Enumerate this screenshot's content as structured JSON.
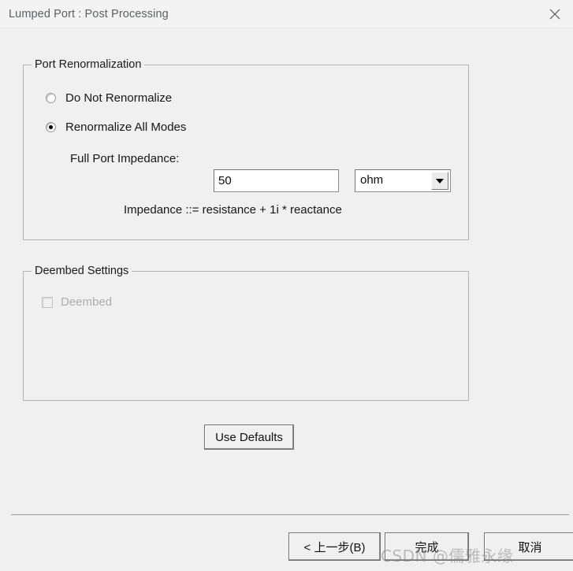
{
  "window": {
    "title": "Lumped Port : Post Processing",
    "close_icon": "close-icon"
  },
  "port_renormalization": {
    "group_title": "Port Renormalization",
    "options": [
      {
        "label": "Do Not Renormalize",
        "selected": false
      },
      {
        "label": "Renormalize All Modes",
        "selected": true
      }
    ],
    "impedance": {
      "label": "Full Port Impedance:",
      "value": "50",
      "placeholder": "",
      "unit_selected": "ohm",
      "unit_options": [
        "ohm"
      ],
      "dropdown_icon": "chevron-down-icon"
    },
    "hint": "Impedance ::= resistance + 1i * reactance"
  },
  "deembed_settings": {
    "group_title": "Deembed Settings",
    "checkbox": {
      "label": "Deembed",
      "checked": false,
      "disabled": true
    }
  },
  "buttons": {
    "use_defaults": "Use Defaults",
    "back": "< 上一步(B)",
    "finish": "完成",
    "cancel": "取消"
  },
  "watermark": {
    "text": "CSDN @儒雅永缘"
  },
  "colors": {
    "dialog_bg": "#f0f0f0",
    "titlebar_bg": "#f3f3f3",
    "title_text": "#5b5f66",
    "group_border": "#b4b4b4",
    "field_bg": "#ffffff",
    "disabled_text": "#acacac"
  }
}
